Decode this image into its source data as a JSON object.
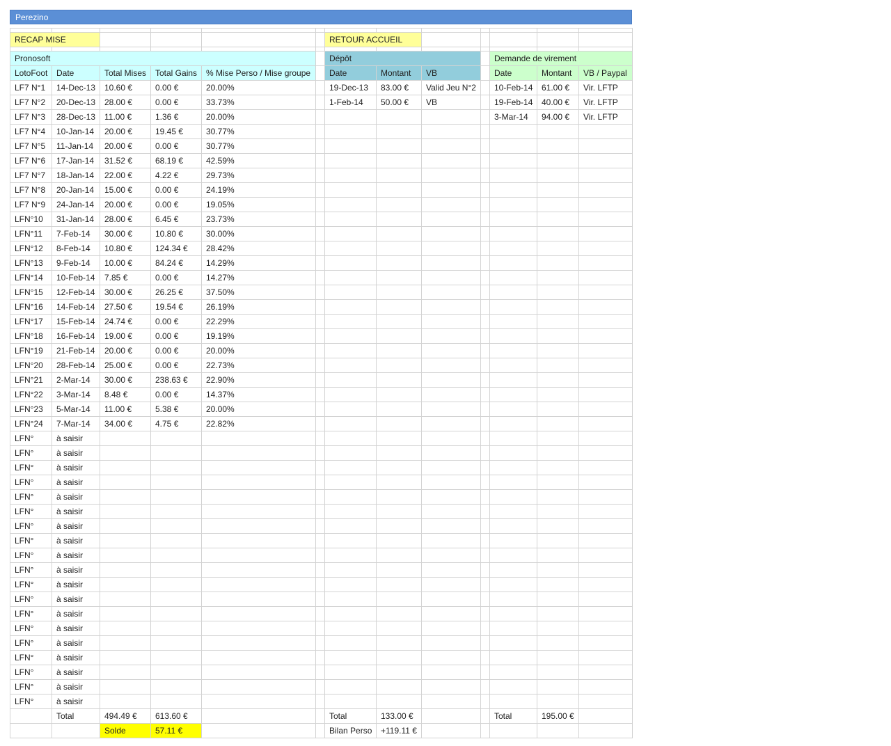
{
  "sheet_title": "Perezino",
  "buttons": {
    "recap": "RECAP MISE",
    "accueil": "RETOUR ACCUEIL"
  },
  "sections": {
    "pronosoft": "Pronosoft",
    "depot": "Dépôt",
    "virement": "Demande de virement"
  },
  "headers": {
    "pronosoft": [
      "LotoFoot",
      "Date",
      "Total Mises",
      "Total Gains",
      "% Mise Perso / Mise groupe"
    ],
    "depot": [
      "Date",
      "Montant",
      "VB"
    ],
    "virement": [
      "Date",
      "Montant",
      "VB / Paypal"
    ]
  },
  "pronosoft_rows": [
    [
      "LF7 N°1",
      "14-Dec-13",
      "10.60 €",
      "0.00 €",
      "20.00%"
    ],
    [
      "LF7 N°2",
      "20-Dec-13",
      "28.00 €",
      "0.00 €",
      "33.73%"
    ],
    [
      "LF7 N°3",
      "28-Dec-13",
      "11.00 €",
      "1.36 €",
      "20.00%"
    ],
    [
      "LF7 N°4",
      "10-Jan-14",
      "20.00 €",
      "19.45 €",
      "30.77%"
    ],
    [
      "LF7 N°5",
      "11-Jan-14",
      "20.00 €",
      "0.00 €",
      "30.77%"
    ],
    [
      "LF7 N°6",
      "17-Jan-14",
      "31.52 €",
      "68.19 €",
      "42.59%"
    ],
    [
      "LF7 N°7",
      "18-Jan-14",
      "22.00 €",
      "4.22 €",
      "29.73%"
    ],
    [
      "LF7 N°8",
      "20-Jan-14",
      "15.00 €",
      "0.00 €",
      "24.19%"
    ],
    [
      "LF7 N°9",
      "24-Jan-14",
      "20.00 €",
      "0.00 €",
      "19.05%"
    ],
    [
      "LFN°10",
      "31-Jan-14",
      "28.00 €",
      "6.45 €",
      "23.73%"
    ],
    [
      "LFN°11",
      "7-Feb-14",
      "30.00 €",
      "10.80 €",
      "30.00%"
    ],
    [
      "LFN°12",
      "8-Feb-14",
      "10.80 €",
      "124.34 €",
      "28.42%"
    ],
    [
      "LFN°13",
      "9-Feb-14",
      "10.00 €",
      "84.24 €",
      "14.29%"
    ],
    [
      "LFN°14",
      "10-Feb-14",
      "7.85 €",
      "0.00 €",
      "14.27%"
    ],
    [
      "LFN°15",
      "12-Feb-14",
      "30.00 €",
      "26.25 €",
      "37.50%"
    ],
    [
      "LFN°16",
      "14-Feb-14",
      "27.50 €",
      "19.54 €",
      "26.19%"
    ],
    [
      "LFN°17",
      "15-Feb-14",
      "24.74 €",
      "0.00 €",
      "22.29%"
    ],
    [
      "LFN°18",
      "16-Feb-14",
      "19.00 €",
      "0.00 €",
      "19.19%"
    ],
    [
      "LFN°19",
      "21-Feb-14",
      "20.00 €",
      "0.00 €",
      "20.00%"
    ],
    [
      "LFN°20",
      "28-Feb-14",
      "25.00 €",
      "0.00 €",
      "22.73%"
    ],
    [
      "LFN°21",
      "2-Mar-14",
      "30.00 €",
      "238.63 €",
      "22.90%"
    ],
    [
      "LFN°22",
      "3-Mar-14",
      "8.48 €",
      "0.00 €",
      "14.37%"
    ],
    [
      "LFN°23",
      "5-Mar-14",
      "11.00 €",
      "5.38 €",
      "20.00%"
    ],
    [
      "LFN°24",
      "7-Mar-14",
      "34.00 €",
      "4.75 €",
      "22.82%"
    ],
    [
      "LFN°",
      "à saisir",
      "",
      "",
      ""
    ],
    [
      "LFN°",
      "à saisir",
      "",
      "",
      ""
    ],
    [
      "LFN°",
      "à saisir",
      "",
      "",
      ""
    ],
    [
      "LFN°",
      "à saisir",
      "",
      "",
      ""
    ],
    [
      "LFN°",
      "à saisir",
      "",
      "",
      ""
    ],
    [
      "LFN°",
      "à saisir",
      "",
      "",
      ""
    ],
    [
      "LFN°",
      "à saisir",
      "",
      "",
      ""
    ],
    [
      "LFN°",
      "à saisir",
      "",
      "",
      ""
    ],
    [
      "LFN°",
      "à saisir",
      "",
      "",
      ""
    ],
    [
      "LFN°",
      "à saisir",
      "",
      "",
      ""
    ],
    [
      "LFN°",
      "à saisir",
      "",
      "",
      ""
    ],
    [
      "LFN°",
      "à saisir",
      "",
      "",
      ""
    ],
    [
      "LFN°",
      "à saisir",
      "",
      "",
      ""
    ],
    [
      "LFN°",
      "à saisir",
      "",
      "",
      ""
    ],
    [
      "LFN°",
      "à saisir",
      "",
      "",
      ""
    ],
    [
      "LFN°",
      "à saisir",
      "",
      "",
      ""
    ],
    [
      "LFN°",
      "à saisir",
      "",
      "",
      ""
    ],
    [
      "LFN°",
      "à saisir",
      "",
      "",
      ""
    ],
    [
      "LFN°",
      "à saisir",
      "",
      "",
      ""
    ]
  ],
  "depot_rows": [
    [
      "19-Dec-13",
      "83.00 €",
      "Valid Jeu N°2"
    ],
    [
      "1-Feb-14",
      "50.00 €",
      "VB"
    ]
  ],
  "virement_rows": [
    [
      "10-Feb-14",
      "61.00 €",
      "Vir. LFTP"
    ],
    [
      "19-Feb-14",
      "40.00 €",
      "Vir. LFTP"
    ],
    [
      "3-Mar-14",
      "94.00 €",
      "Vir. LFTP"
    ]
  ],
  "totals": {
    "label": "Total",
    "mises": "494.49 €",
    "gains": "613.60 €",
    "solde_label": "Solde",
    "solde": "57.11 €",
    "depot_label": "Total",
    "depot": "133.00 €",
    "bilan_label": "Bilan Perso",
    "bilan": "+119.11 €",
    "virement_label": "Total",
    "virement": "195.00 €"
  },
  "colors": {
    "title_bar": "#5b8fd6",
    "button": "#ffff99",
    "pronosoft_header": "#ccffff",
    "depot_header": "#92cddc",
    "virement_header": "#ccffcc",
    "solde": "#ffff00"
  }
}
